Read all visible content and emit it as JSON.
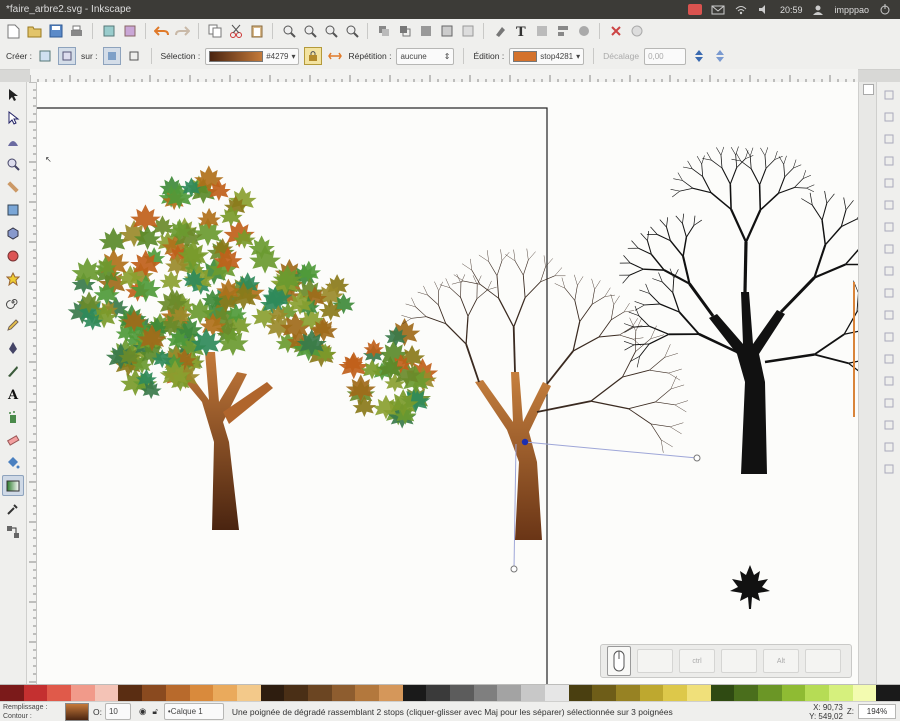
{
  "window": {
    "title": "*faire_arbre2.svg - Inkscape"
  },
  "tray": {
    "clock": "20:59",
    "user": "impppao",
    "icons": [
      "session-red-icon",
      "envelope-icon",
      "wifi-icon",
      "volume-icon",
      "battery-icon",
      "user-icon"
    ]
  },
  "toolbar1": {
    "icons": [
      "new-document-icon",
      "open-icon",
      "save-icon",
      "print-icon",
      "import-icon",
      "export-icon",
      "undo-icon",
      "redo-icon",
      "copy-icon",
      "cut-icon",
      "paste-icon",
      "zoom-selection-icon",
      "zoom-drawing-icon",
      "zoom-page-icon",
      "zoom-width-icon",
      "duplicate-icon",
      "clone-icon",
      "unlink-clone-icon",
      "group-icon",
      "ungroup-icon",
      "fill-stroke-icon",
      "text-font-icon",
      "xml-editor-icon",
      "align-icon",
      "preferences-icon",
      "document-properties-icon"
    ]
  },
  "toolbar2": {
    "create_label": "Créer :",
    "on_label": "sur :",
    "selection_label": "Sélection :",
    "selection_value": "#4279",
    "repeat_label": "Répétition :",
    "repeat_value": "aucune",
    "edit_label": "Édition :",
    "edit_value": "stop4281",
    "offset_label": "Décalage",
    "offset_value": "0,00"
  },
  "tools": [
    "selector-arrow-icon",
    "node-edit-icon",
    "tweak-icon",
    "zoom-icon",
    "measure-icon",
    "rectangle-icon",
    "3d-box-icon",
    "ellipse-icon",
    "star-icon",
    "spiral-icon",
    "pencil-icon",
    "pen-icon",
    "calligraphy-icon",
    "text-tool-icon",
    "spray-icon",
    "eraser-icon",
    "paint-bucket-icon",
    "gradient-icon",
    "dropper-icon",
    "connector-icon"
  ],
  "right_commands": [
    "snap-toggle-icon",
    "snap-bbox-icon",
    "snap-bbox-edge-icon",
    "snap-bbox-corner-icon",
    "snap-bbox-midpoint-icon",
    "snap-bbox-center-icon",
    "snap-nodes-icon",
    "snap-path-icon",
    "snap-intersection-icon",
    "snap-cusp-icon",
    "snap-smooth-icon",
    "snap-midpoint-icon",
    "snap-object-center-icon",
    "snap-rotation-center-icon",
    "snap-text-baseline-icon",
    "snap-page-border-icon",
    "snap-grid-icon",
    "snap-guide-icon"
  ],
  "statusbar": {
    "fill_label": "Remplissage :",
    "stroke_label": "Contour :",
    "opacity": "O:",
    "opacity_value": "10",
    "layer": "•Calque 1",
    "message": "Une poignée de dégradé rassemblant 2 stops (cliquer-glisser avec Maj pour les séparer) sélectionnée sur 3 poignées",
    "x_label": "X:",
    "x_value": "90,73",
    "y_label": "Y:",
    "y_value": "549,02",
    "z_label": "Z:",
    "zoom": "194%"
  },
  "snapbar": {
    "labels": [
      "",
      "",
      "ctrl",
      "",
      "Alt"
    ]
  },
  "colors": {
    "gradient_start": "#4a2410",
    "gradient_end": "#c47a3a",
    "edit_stop": "#d4722c",
    "selection_handle": "#1b2fb0"
  },
  "palette": [
    "#7b1a1a",
    "#c43030",
    "#e05a4a",
    "#f19a8a",
    "#f4c3b6",
    "#5a2d12",
    "#8a4a1f",
    "#b86a2c",
    "#d98a3c",
    "#eaaa5c",
    "#f3c98a",
    "#2e1d0f",
    "#4a2f16",
    "#6b4522",
    "#8e5d2f",
    "#b3783d",
    "#d5975a",
    "#1a1a1a",
    "#3a3a3a",
    "#5c5c5c",
    "#7f7f7f",
    "#a3a3a3",
    "#c8c8c8",
    "#e6e6e6",
    "#4a3f10",
    "#6e5d18",
    "#978223",
    "#bea82f",
    "#ddc84a",
    "#f0e07a",
    "#2f4a12",
    "#4a6e1c",
    "#6b9626",
    "#8fbb33",
    "#b6dc55",
    "#d6f07d",
    "#f3fbb0",
    "#1a1a1a"
  ]
}
